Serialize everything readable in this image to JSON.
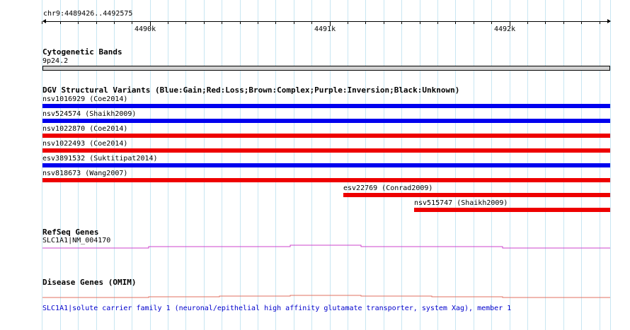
{
  "ruler": {
    "range_label": "chr9:4489426..4492575",
    "tick_labels": [
      "4490k",
      "4491k",
      "4492k"
    ]
  },
  "cytogenetic": {
    "title": "Cytogenetic Bands",
    "band_label": "9p24.2",
    "band_color": "#d0d0d0"
  },
  "dgv": {
    "title": "DGV Structural Variants (Blue:Gain;Red:Loss;Brown:Complex;Purple:Inversion;Black:Unknown)",
    "variants": [
      {
        "label": "nsv1016929 (Coe2014)",
        "type": "gain"
      },
      {
        "label": "nsv524574 (Shaikh2009)",
        "type": "gain"
      },
      {
        "label": "nsv1022870 (Coe2014)",
        "type": "loss"
      },
      {
        "label": "nsv1022493 (Coe2014)",
        "type": "loss"
      },
      {
        "label": "esv3891532 (Suktitipat2014)",
        "type": "gain"
      },
      {
        "label": "nsv818673 (Wang2007)",
        "type": "loss"
      },
      {
        "label": "esv22769 (Conrad2009)",
        "type": "loss"
      },
      {
        "label": "nsv515747 (Shaikh2009)",
        "type": "loss"
      }
    ],
    "colors": {
      "gain": "#0000ee",
      "loss": "#ee0000"
    }
  },
  "refseq": {
    "title": "RefSeq Genes",
    "gene_label": "SLC1A1|NM_004170",
    "line_color": "#cc44cc"
  },
  "omim": {
    "title": "Disease Genes (OMIM)",
    "gene_label": "SLC1A1|solute carrier family 1 (neuronal/epithelial high affinity glutamate transporter, system Xag), member 1",
    "line_color": "#e07060",
    "label_color": "#0000cc"
  },
  "grid_color": "#c8e6f2"
}
